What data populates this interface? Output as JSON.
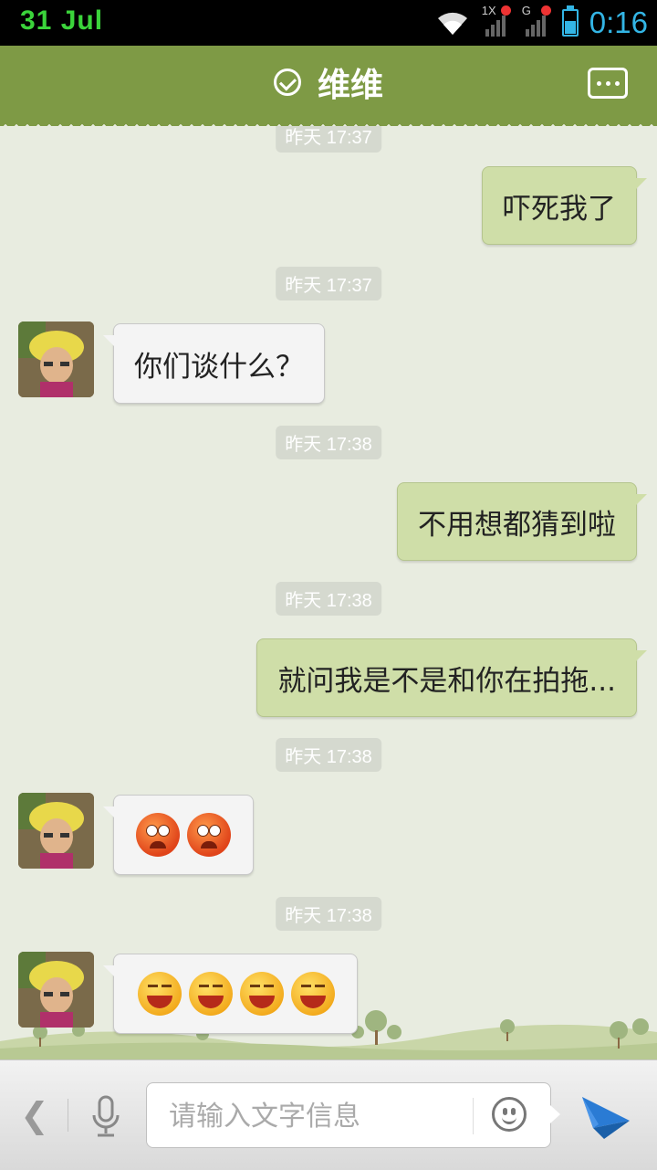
{
  "status_bar": {
    "date": "31 Jul",
    "time": "0:16",
    "signal1_label": "1X",
    "signal2_label": "G"
  },
  "header": {
    "title": "维维",
    "online_icon": "check-circle-icon",
    "menu_icon": "more-icon"
  },
  "messages": [
    {
      "kind": "time",
      "text": "昨天 17:37"
    },
    {
      "kind": "out",
      "text": "吓死我了"
    },
    {
      "kind": "time",
      "text": "昨天 17:37"
    },
    {
      "kind": "in",
      "text": "你们谈什么？"
    },
    {
      "kind": "time",
      "text": "昨天 17:38"
    },
    {
      "kind": "out",
      "text": "不用想都猜到啦"
    },
    {
      "kind": "time",
      "text": "昨天 17:38"
    },
    {
      "kind": "out",
      "text": "就问我是不是和你在拍拖..."
    },
    {
      "kind": "time",
      "text": "昨天 17:38"
    },
    {
      "kind": "in",
      "emoji": [
        "angry-face",
        "angry-face"
      ]
    },
    {
      "kind": "time",
      "text": "昨天 17:38"
    },
    {
      "kind": "in",
      "emoji": [
        "laughing-face",
        "laughing-face",
        "laughing-face",
        "laughing-face"
      ]
    }
  ],
  "input_bar": {
    "placeholder": "请输入文字信息",
    "back_icon": "chevron-left-icon",
    "voice_icon": "microphone-icon",
    "emoji_icon": "smiley-icon",
    "send_icon": "paper-plane-icon"
  },
  "colors": {
    "header": "#7e9a45",
    "outgoing_bubble": "#cfdea8",
    "time_color": "#33b5e5"
  }
}
